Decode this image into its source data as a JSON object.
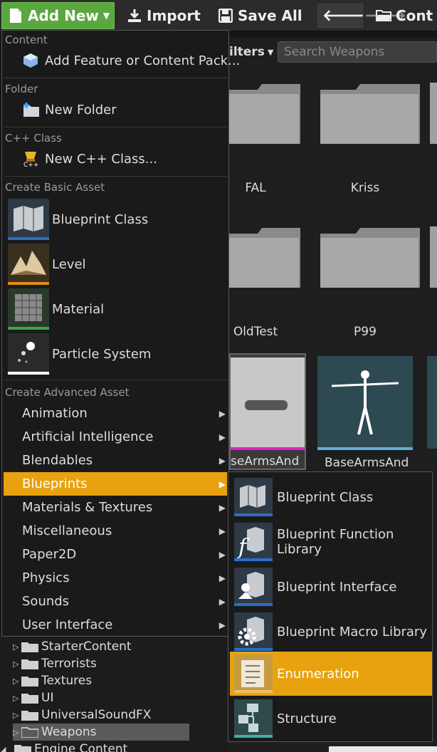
{
  "toolbar": {
    "add_new": "Add New",
    "import": "Import",
    "save_all": "Save All",
    "content_truncated": "Cont"
  },
  "content": {
    "filters": "ilters",
    "search_placeholder": "Search Weapons",
    "folders": [
      {
        "label": "FAL"
      },
      {
        "label": "Kriss"
      },
      {
        "label": "OldTest"
      },
      {
        "label": "P99"
      }
    ],
    "assets": [
      {
        "label": "seArmsAnd"
      },
      {
        "label": "BaseArmsAnd"
      }
    ]
  },
  "menu": {
    "sections": {
      "content": "Content",
      "folder": "Folder",
      "cpp": "C++ Class",
      "basic": "Create Basic Asset",
      "advanced": "Create Advanced Asset"
    },
    "add_feature": "Add Feature or Content Pack...",
    "new_folder": "New Folder",
    "new_cpp": "New C++ Class...",
    "basic_assets": [
      {
        "label": "Blueprint Class",
        "color": "#2a6fc4"
      },
      {
        "label": "Level",
        "color": "#e08a1a"
      },
      {
        "label": "Material",
        "color": "#3aa84a"
      },
      {
        "label": "Particle System",
        "color": "#ffffff"
      }
    ],
    "advanced_items": [
      {
        "label": "Animation"
      },
      {
        "label": "Artificial Intelligence"
      },
      {
        "label": "Blendables"
      },
      {
        "label": "Blueprints",
        "selected": true
      },
      {
        "label": "Materials & Textures"
      },
      {
        "label": "Miscellaneous"
      },
      {
        "label": "Paper2D"
      },
      {
        "label": "Physics"
      },
      {
        "label": "Sounds"
      },
      {
        "label": "User Interface"
      }
    ]
  },
  "submenu": {
    "items": [
      {
        "label": "Blueprint Class"
      },
      {
        "label": "Blueprint Function Library"
      },
      {
        "label": "Blueprint Interface"
      },
      {
        "label": "Blueprint Macro Library"
      },
      {
        "label": "Enumeration",
        "selected": true
      },
      {
        "label": "Structure"
      }
    ]
  },
  "tree": {
    "items": [
      {
        "label": "StarterContent"
      },
      {
        "label": "Terrorists"
      },
      {
        "label": "Textures"
      },
      {
        "label": "UI"
      },
      {
        "label": "UniversalSoundFX"
      },
      {
        "label": "Weapons",
        "selected": true
      }
    ],
    "engine_content": "Engine Content"
  },
  "colors": {
    "accent": "#e8a210",
    "add_new": "#5ba73f"
  }
}
